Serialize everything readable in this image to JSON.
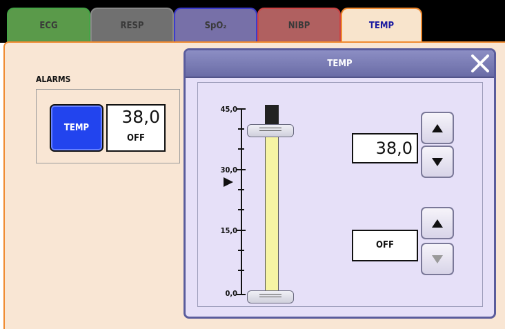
{
  "tabs": [
    {
      "label": "ECG"
    },
    {
      "label": "RESP"
    },
    {
      "label": "SpO₂"
    },
    {
      "label": "NIBP"
    },
    {
      "label": "TEMP"
    }
  ],
  "alarms": {
    "heading": "ALARMS",
    "button_label": "TEMP",
    "limit_value": "38,0",
    "low_value": "OFF"
  },
  "dialog": {
    "title": "TEMP",
    "scale": [
      "45,0",
      "30,0",
      "15,0",
      "0,0"
    ],
    "high_limit": "38,0",
    "low_limit": "OFF",
    "scale_max": 45.0,
    "slider_fraction_top": 0.91,
    "slider_fraction_bottom": 0.0
  },
  "colors": {
    "panel_bg": "#f9e6d4",
    "tab_active_border": "#f08a30",
    "dialog_bg": "#e6e0f8",
    "alarm_button": "#2244ee",
    "slider_fill": "#f6f4a4"
  },
  "icons": [
    "close-icon",
    "up-arrow-icon",
    "down-arrow-icon",
    "pointer-icon",
    "slider-handle-icon"
  ]
}
